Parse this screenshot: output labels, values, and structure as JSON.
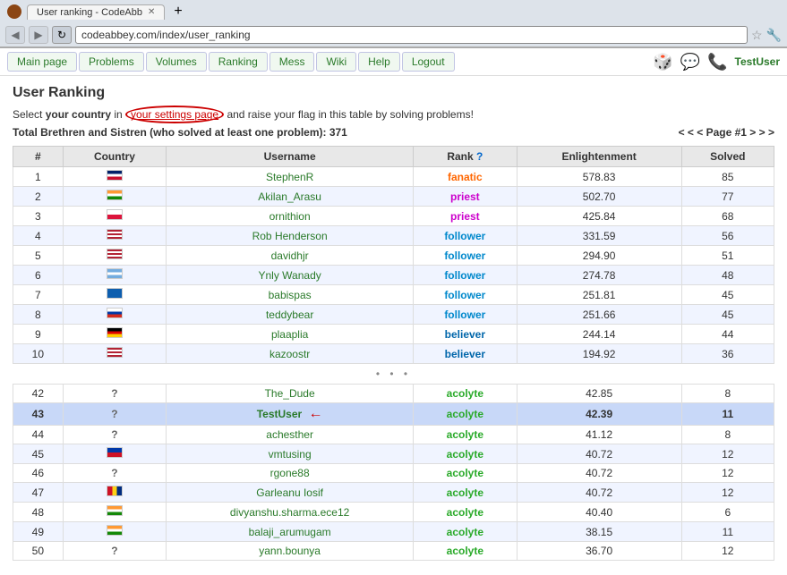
{
  "browser": {
    "title": "User ranking - CodeAbb",
    "url": "codeabbey.com/index/user_ranking",
    "tab_label": "User ranking - CodeAbb"
  },
  "nav": {
    "links": [
      "Main page",
      "Problems",
      "Volumes",
      "Ranking",
      "Mess",
      "Wiki",
      "Help",
      "Logout"
    ],
    "user": "TestUser"
  },
  "page": {
    "title": "User Ranking",
    "settings_text": "Select your country in",
    "settings_link": "your settings page",
    "settings_text2": "and raise your flag in this table by solving problems!",
    "total_label": "Total Brethren and Sistren (who solved at least one problem): 371",
    "pagination": "< < <  Page #1  > > >"
  },
  "table": {
    "headers": [
      "#",
      "Country",
      "Username",
      "Rank ?",
      "Enlightenment",
      "Solved"
    ],
    "rows": [
      {
        "rank": 1,
        "flag": "uk",
        "username": "StephenR",
        "user_rank": "fanatic",
        "rank_class": "rank-fanatic",
        "enlightenment": "578.83",
        "solved": 85
      },
      {
        "rank": 2,
        "flag": "india",
        "username": "Akilan_Arasu",
        "user_rank": "priest",
        "rank_class": "rank-priest",
        "enlightenment": "502.70",
        "solved": 77
      },
      {
        "rank": 3,
        "flag": "poland",
        "username": "ornithion",
        "user_rank": "priest",
        "rank_class": "rank-priest",
        "enlightenment": "425.84",
        "solved": 68
      },
      {
        "rank": 4,
        "flag": "usa",
        "username": "Rob Henderson",
        "user_rank": "follower",
        "rank_class": "rank-follower",
        "enlightenment": "331.59",
        "solved": 56
      },
      {
        "rank": 5,
        "flag": "usa",
        "username": "davidhjr",
        "user_rank": "follower",
        "rank_class": "rank-follower",
        "enlightenment": "294.90",
        "solved": 51
      },
      {
        "rank": 6,
        "flag": "argentina",
        "username": "Ynly Wanady",
        "user_rank": "follower",
        "rank_class": "rank-follower",
        "enlightenment": "274.78",
        "solved": 48
      },
      {
        "rank": 7,
        "flag": "greece",
        "username": "babispas",
        "user_rank": "follower",
        "rank_class": "rank-follower",
        "enlightenment": "251.81",
        "solved": 45
      },
      {
        "rank": 8,
        "flag": "russia",
        "username": "teddybear",
        "user_rank": "follower",
        "rank_class": "rank-follower",
        "enlightenment": "251.66",
        "solved": 45
      },
      {
        "rank": 9,
        "flag": "germany",
        "username": "plaaplia",
        "user_rank": "believer",
        "rank_class": "rank-believer",
        "enlightenment": "244.14",
        "solved": 44
      },
      {
        "rank": 10,
        "flag": "usa",
        "username": "kazoostr",
        "user_rank": "believer",
        "rank_class": "rank-believer",
        "enlightenment": "194.92",
        "solved": 36
      }
    ],
    "lower_rows": [
      {
        "rank": 42,
        "flag": "?",
        "username": "The_Dude",
        "user_rank": "acolyte",
        "rank_class": "rank-acolyte",
        "enlightenment": "42.85",
        "solved": 8,
        "highlight": false
      },
      {
        "rank": 43,
        "flag": "?",
        "username": "TestUser",
        "user_rank": "acolyte",
        "rank_class": "rank-acolyte",
        "enlightenment": "42.39",
        "solved": 11,
        "highlight": true,
        "arrow": true
      },
      {
        "rank": 44,
        "flag": "?",
        "username": "achesther",
        "user_rank": "acolyte",
        "rank_class": "rank-acolyte",
        "enlightenment": "41.12",
        "solved": 8,
        "highlight": false
      },
      {
        "rank": 45,
        "flag": "philippines",
        "username": "vmtusing",
        "user_rank": "acolyte",
        "rank_class": "rank-acolyte",
        "enlightenment": "40.72",
        "solved": 12,
        "highlight": false
      },
      {
        "rank": 46,
        "flag": "?",
        "username": "rgone88",
        "user_rank": "acolyte",
        "rank_class": "rank-acolyte",
        "enlightenment": "40.72",
        "solved": 12,
        "highlight": false
      },
      {
        "rank": 47,
        "flag": "romania",
        "username": "Garleanu Iosif",
        "user_rank": "acolyte",
        "rank_class": "rank-acolyte",
        "enlightenment": "40.72",
        "solved": 12,
        "highlight": false
      },
      {
        "rank": 48,
        "flag": "india",
        "username": "divyanshu.sharma.ece12",
        "user_rank": "acolyte",
        "rank_class": "rank-acolyte",
        "enlightenment": "40.40",
        "solved": 6,
        "highlight": false
      },
      {
        "rank": 49,
        "flag": "india",
        "username": "balaji_arumugam",
        "user_rank": "acolyte",
        "rank_class": "rank-acolyte",
        "enlightenment": "38.15",
        "solved": 11,
        "highlight": false
      },
      {
        "rank": 50,
        "flag": "?",
        "username": "yann.bounya",
        "user_rank": "acolyte",
        "rank_class": "rank-acolyte",
        "enlightenment": "36.70",
        "solved": 12,
        "highlight": false
      }
    ]
  }
}
